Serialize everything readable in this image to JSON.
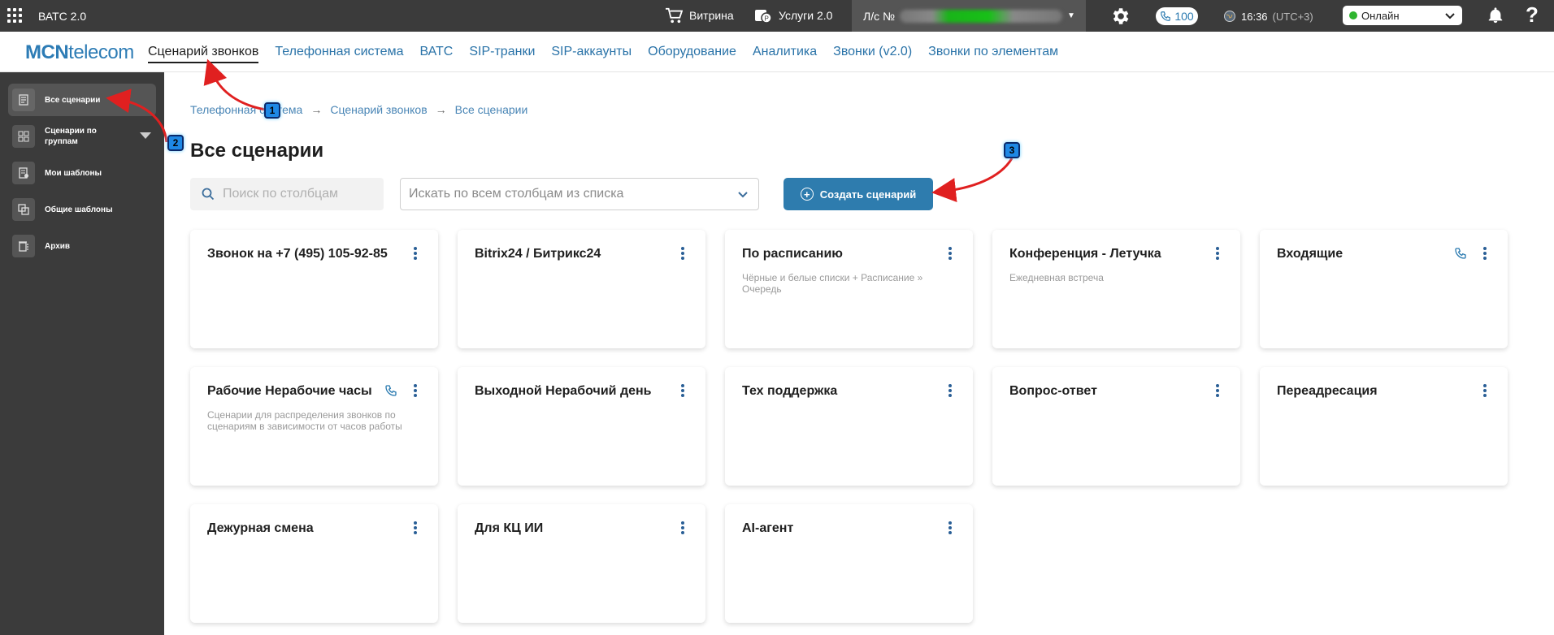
{
  "topbar": {
    "app_title": "ВАТС 2.0",
    "showcase_label": "Витрина",
    "services_label": "Услуги 2.0",
    "account_prefix": "Л/с №",
    "calls_count": "100",
    "time": "16:36",
    "timezone": "(UTC+3)",
    "status": "Онлайн",
    "help": "?"
  },
  "navbar": {
    "logo_bold": "MCN",
    "logo_rest": "telecom",
    "items": [
      "Сценарий звонков",
      "Телефонная система",
      "ВАТС",
      "SIP-транки",
      "SIP-аккаунты",
      "Оборудование",
      "Аналитика",
      "Звонки (v2.0)",
      "Звонки по элементам"
    ]
  },
  "sidebar": {
    "items": [
      {
        "label": "Все сценарии",
        "icon": "document-icon"
      },
      {
        "label": "Сценарии по группам",
        "icon": "grid-icon"
      },
      {
        "label": "Мои шаблоны",
        "icon": "template-icon"
      },
      {
        "label": "Общие шаблоны",
        "icon": "copy-icon"
      },
      {
        "label": "Архив",
        "icon": "archive-icon"
      }
    ]
  },
  "breadcrumb": [
    "Телефонная система",
    "Сценарий звонков",
    "Все сценарии"
  ],
  "breadcrumb_sep": "→",
  "page_title": "Все сценарии",
  "search": {
    "columns_placeholder": "Поиск по столбцам",
    "all_placeholder": "Искать по всем столбцам из списка"
  },
  "create_button": "Создать сценарий",
  "cards": [
    {
      "title": "Звонок на +7 (495) 105-92-85",
      "desc": "",
      "phone": false
    },
    {
      "title": "Bitrix24 / Битрикс24",
      "desc": "",
      "phone": false
    },
    {
      "title": "По расписанию",
      "desc": "Чёрные и белые списки + Расписание » Очередь",
      "phone": false
    },
    {
      "title": "Конференция - Летучка",
      "desc": "Ежедневная встреча",
      "phone": false
    },
    {
      "title": "Входящие",
      "desc": "",
      "phone": true
    },
    {
      "title": "Рабочие Нерабочие часы",
      "desc": "Сценарии для распределения звонков по сценариям в зависимости от часов работы",
      "phone": true
    },
    {
      "title": "Выходной Нерабочий день",
      "desc": "",
      "phone": false
    },
    {
      "title": "Тех поддержка",
      "desc": "",
      "phone": false
    },
    {
      "title": "Вопрос-ответ",
      "desc": "",
      "phone": false
    },
    {
      "title": "Переадресация",
      "desc": "",
      "phone": false
    },
    {
      "title": "Дежурная смена",
      "desc": "",
      "phone": false
    },
    {
      "title": "Для КЦ ИИ",
      "desc": "",
      "phone": false
    },
    {
      "title": "AI-агент",
      "desc": "",
      "phone": false
    }
  ],
  "annotations": [
    "1",
    "2",
    "3"
  ],
  "colors": {
    "accent": "#2e7cae",
    "topbar": "#3b3b3b",
    "annotation_arrow": "#e02020",
    "online": "#2fb52f"
  }
}
